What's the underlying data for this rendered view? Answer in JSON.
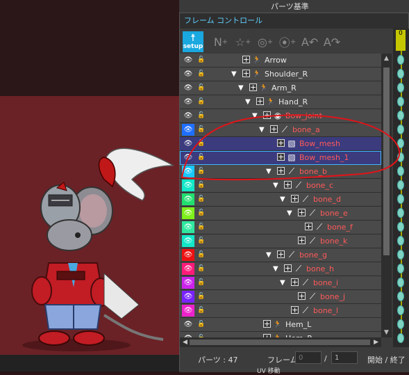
{
  "panel": {
    "title": "フレーム コントロール",
    "setup_label": "setup"
  },
  "background": {
    "top_fragment": "パーツ基準",
    "bottom_fragment": "UV 移動"
  },
  "colors": {
    "accent": "#19a8e0",
    "red_label": "#ff5a5a",
    "annotation": "#e0141a"
  },
  "rows": [
    {
      "label": "Arrow",
      "red": false,
      "indent": 0,
      "tri": false,
      "icon": "walk",
      "swatch": null
    },
    {
      "label": "Shoulder_R",
      "red": false,
      "indent": 0,
      "tri": true,
      "icon": "walk",
      "swatch": null
    },
    {
      "label": "Arm_R",
      "red": false,
      "indent": 1,
      "tri": true,
      "icon": "walk",
      "swatch": null
    },
    {
      "label": "Hand_R",
      "red": false,
      "indent": 2,
      "tri": true,
      "icon": "walk",
      "swatch": null
    },
    {
      "label": "Bow_joint",
      "red": true,
      "indent": 3,
      "tri": true,
      "icon": "target",
      "swatch": null
    },
    {
      "label": "bone_a",
      "red": true,
      "indent": 4,
      "tri": true,
      "icon": "bone",
      "swatch": "#1f6fff"
    },
    {
      "label": "Bow_mesh",
      "red": true,
      "indent": 5,
      "tri": false,
      "icon": "mesh",
      "swatch": null
    },
    {
      "label": "Bow_mesh_1",
      "red": true,
      "indent": 5,
      "tri": false,
      "icon": "mesh",
      "swatch": null
    },
    {
      "label": "bone_b",
      "red": true,
      "indent": 5,
      "tri": true,
      "icon": "bone",
      "swatch": "#18c8ff"
    },
    {
      "label": "bone_c",
      "red": true,
      "indent": 6,
      "tri": true,
      "icon": "bone",
      "swatch": "#12e8c8"
    },
    {
      "label": "bone_d",
      "red": true,
      "indent": 7,
      "tri": true,
      "icon": "bone",
      "swatch": "#22e070"
    },
    {
      "label": "bone_e",
      "red": true,
      "indent": 8,
      "tri": true,
      "icon": "bone",
      "swatch": "#7ef01a"
    },
    {
      "label": "bone_f",
      "red": true,
      "indent": 9,
      "tri": false,
      "icon": "bone",
      "swatch": "#2ee8a0"
    },
    {
      "label": "bone_k",
      "red": true,
      "indent": 8,
      "tri": false,
      "icon": "bone",
      "swatch": "#12e8c8"
    },
    {
      "label": "bone_g",
      "red": true,
      "indent": 5,
      "tri": true,
      "icon": "bone",
      "swatch": "#ee1111"
    },
    {
      "label": "bone_h",
      "red": true,
      "indent": 6,
      "tri": true,
      "icon": "bone",
      "swatch": "#ff1a7a"
    },
    {
      "label": "bone_i",
      "red": true,
      "indent": 7,
      "tri": true,
      "icon": "bone",
      "swatch": "#cc22ee"
    },
    {
      "label": "bone_j",
      "red": true,
      "indent": 8,
      "tri": false,
      "icon": "bone",
      "swatch": "#7a22ff"
    },
    {
      "label": "bone_l",
      "red": true,
      "indent": 7,
      "tri": false,
      "icon": "bone",
      "swatch": "#ee22cc"
    },
    {
      "label": "Hem_L",
      "red": false,
      "indent": 3,
      "tri": false,
      "icon": "walk",
      "swatch": null
    },
    {
      "label": "Hem_R",
      "red": false,
      "indent": 3,
      "tri": false,
      "icon": "walk",
      "swatch": null
    }
  ],
  "status": {
    "parts_label": "パーツ : 47",
    "frame_label": "フレーム :",
    "frame_current": "0",
    "slash": "/",
    "frame_total": "1",
    "start_end": "開始 / 終了"
  },
  "timeline": {
    "marker": "0"
  }
}
